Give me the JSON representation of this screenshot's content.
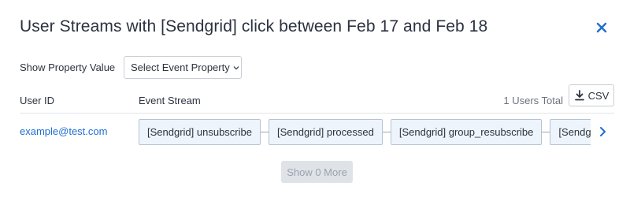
{
  "modal": {
    "title": "User Streams with [Sendgrid] click between Feb 17 and Feb 18",
    "close_icon": "close-icon",
    "accent_color": "#1f6fd1"
  },
  "filters": {
    "property_label": "Show Property Value",
    "property_select_value": "Select Event Property",
    "select_icon": "chevron-down-icon"
  },
  "table": {
    "columns": [
      "User ID",
      "Event Stream"
    ],
    "total_label": "1 Users Total",
    "csv_label": "CSV",
    "csv_icon": "download-icon",
    "rows": [
      {
        "user_id": "example@test.com",
        "events": [
          "[Sendgrid] unsubscribe",
          "[Sendgrid] processed",
          "[Sendgrid] group_resubscribe",
          "[Sendgrid] open"
        ]
      }
    ],
    "scroll_icon": "chevron-right-icon"
  },
  "footer": {
    "show_more_label": "Show 0 More"
  }
}
